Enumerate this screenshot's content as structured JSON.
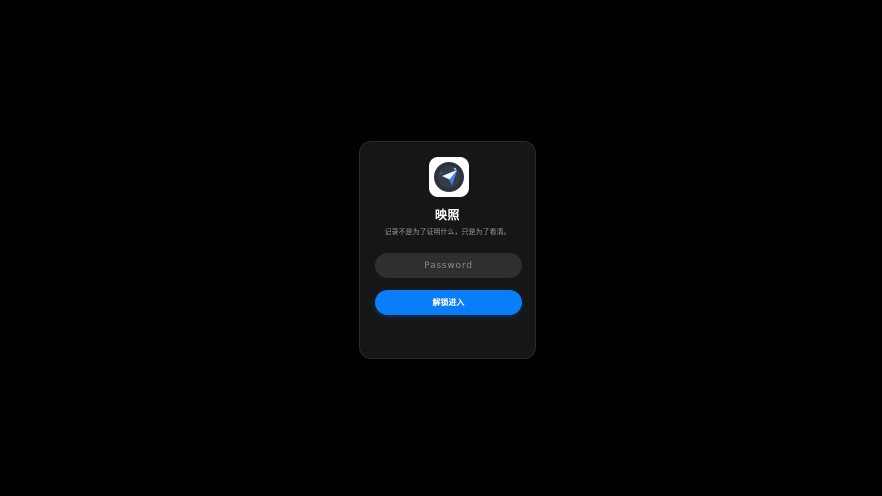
{
  "app": {
    "icon": "paper-plane-app-icon",
    "title": "映照",
    "subtitle": "记录不是为了证明什么，只是为了看清。"
  },
  "form": {
    "password_placeholder": "Password",
    "password_value": "",
    "unlock_label": "解锁进入"
  },
  "colors": {
    "background": "#000000",
    "card": "#161616",
    "input": "#2f2f2f",
    "accent": "#0a7dfa",
    "icon_ring": "#2c3340",
    "icon_plane": "#3b82f6"
  }
}
